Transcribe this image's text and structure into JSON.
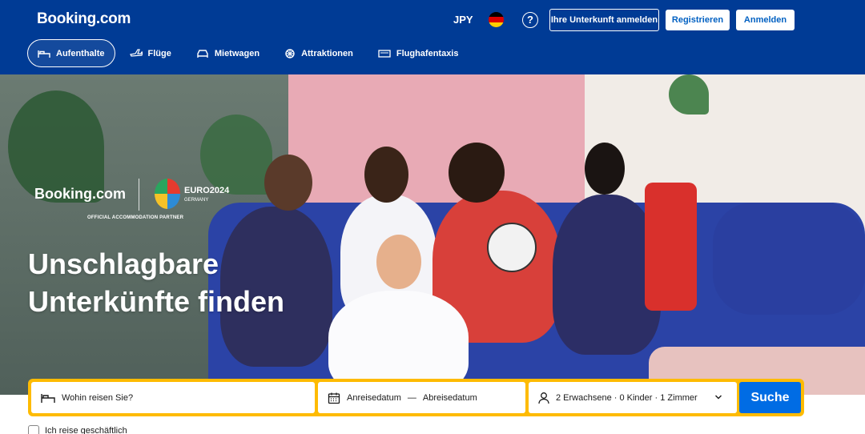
{
  "header": {
    "logo": "Booking.com",
    "currency": "JPY",
    "list_property": "Ihre Unterkunft anmelden",
    "register": "Registrieren",
    "login": "Anmelden",
    "help_icon": "?"
  },
  "nav": {
    "items": [
      {
        "label": "Aufenthalte",
        "icon": "bed-icon",
        "active": true
      },
      {
        "label": "Flüge",
        "icon": "plane-icon",
        "active": false
      },
      {
        "label": "Mietwagen",
        "icon": "car-icon",
        "active": false
      },
      {
        "label": "Attraktionen",
        "icon": "attractions-icon",
        "active": false
      },
      {
        "label": "Flughafentaxis",
        "icon": "taxi-icon",
        "active": false
      }
    ]
  },
  "hero": {
    "brand": "Booking.com",
    "euro_title": "EURO2024",
    "euro_sub": "GERMANY",
    "partner": "OFFICIAL ACCOMMODATION PARTNER",
    "headline": "Unschlagbare Unterkünfte finden"
  },
  "search": {
    "destination_placeholder": "Wohin reisen Sie?",
    "checkin": "Anreisedatum",
    "dash": "—",
    "checkout": "Abreisedatum",
    "guests": "2 Erwachsene · 0 Kinder · 1 Zimmer",
    "button": "Suche"
  },
  "business_travel": "Ich reise geschäftlich",
  "colors": {
    "brand_blue": "#003b95",
    "search_yellow": "#febb02",
    "button_blue": "#006ce4"
  }
}
